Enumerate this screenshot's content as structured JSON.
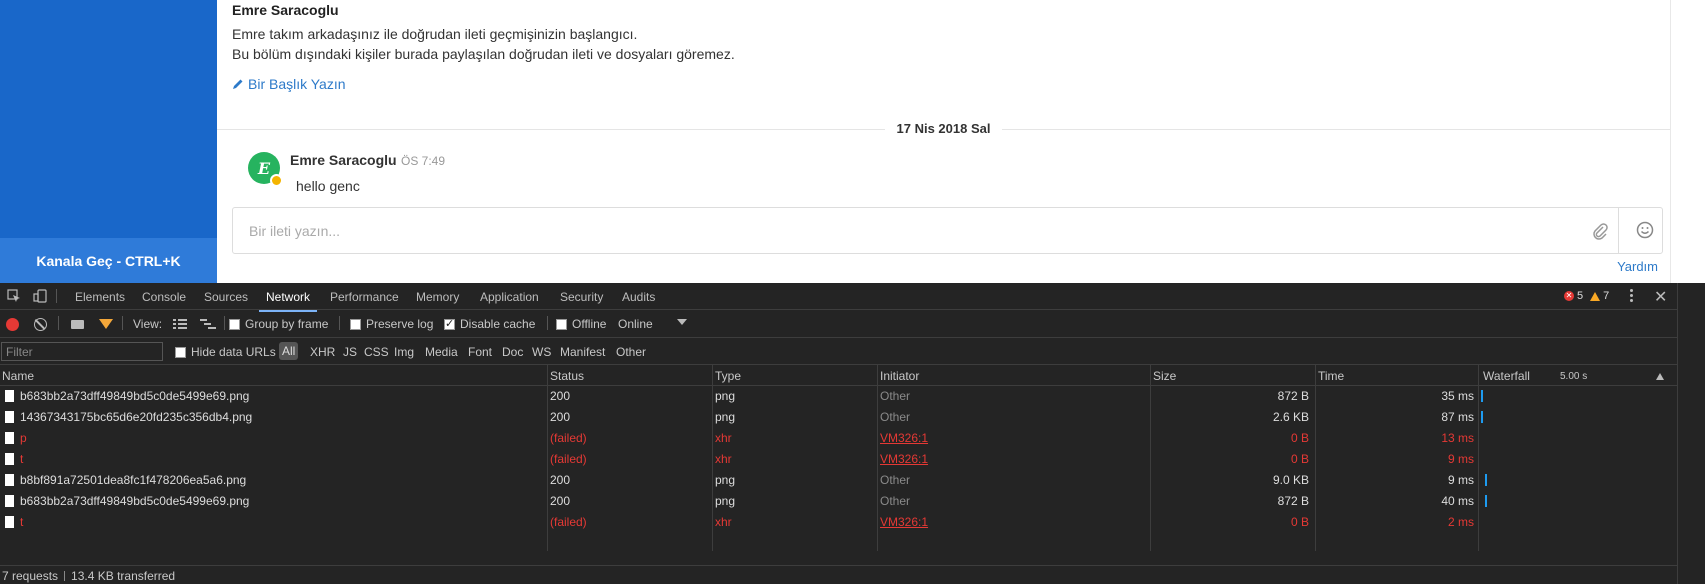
{
  "sidebar": {
    "switcher_label": "Kanala Geç - CTRL+K"
  },
  "intro": {
    "name": "Emre Saracoglu",
    "line1": "Emre takım arkadaşınız ile doğrudan ileti geçmişinizin başlangıcı.",
    "line2": "Bu bölüm dışındaki kişiler burada paylaşılan doğrudan ileti ve dosyaları göremez.",
    "set_title": "Bir Başlık Yazın"
  },
  "date_divider": "17 Nis 2018 Sal",
  "message": {
    "avatar_letter": "E",
    "author": "Emre Saracoglu",
    "time": "ÖS 7:49",
    "body": "hello genc"
  },
  "composer": {
    "placeholder": "Bir ileti yazın..."
  },
  "help_label": "Yardım",
  "devtools": {
    "tabs": [
      "Elements",
      "Console",
      "Sources",
      "Network",
      "Performance",
      "Memory",
      "Application",
      "Security",
      "Audits"
    ],
    "active_tab": "Network",
    "errors": "5",
    "warnings": "7",
    "toolbar": {
      "view_label": "View:",
      "group_by_frame": "Group by frame",
      "preserve_log": "Preserve log",
      "disable_cache": "Disable cache",
      "offline": "Offline",
      "online": "Online"
    },
    "filter": {
      "placeholder": "Filter",
      "hide_data_urls": "Hide data URLs",
      "types": [
        "All",
        "XHR",
        "JS",
        "CSS",
        "Img",
        "Media",
        "Font",
        "Doc",
        "WS",
        "Manifest",
        "Other"
      ]
    },
    "columns": {
      "name": "Name",
      "status": "Status",
      "type": "Type",
      "initiator": "Initiator",
      "size": "Size",
      "time": "Time",
      "waterfall": "Waterfall",
      "waterfall_scale": "5.00 s"
    },
    "requests": [
      {
        "name": "b683bb2a73dff49849bd5c0de5499e69.png",
        "status": "200",
        "type": "png",
        "initiator": "Other",
        "size": "872 B",
        "time": "35 ms",
        "failed": false
      },
      {
        "name": "14367343175bc65d6e20fd235c356db4.png",
        "status": "200",
        "type": "png",
        "initiator": "Other",
        "size": "2.6 KB",
        "time": "87 ms",
        "failed": false
      },
      {
        "name": "p",
        "status": "(failed)",
        "type": "xhr",
        "initiator": "VM326:1",
        "size": "0 B",
        "time": "13 ms",
        "failed": true
      },
      {
        "name": "t",
        "status": "(failed)",
        "type": "xhr",
        "initiator": "VM326:1",
        "size": "0 B",
        "time": "9 ms",
        "failed": true
      },
      {
        "name": "b8bf891a72501dea8fc1f478206ea5a6.png",
        "status": "200",
        "type": "png",
        "initiator": "Other",
        "size": "9.0 KB",
        "time": "9 ms",
        "failed": false
      },
      {
        "name": "b683bb2a73dff49849bd5c0de5499e69.png",
        "status": "200",
        "type": "png",
        "initiator": "Other",
        "size": "872 B",
        "time": "40 ms",
        "failed": false
      },
      {
        "name": "t",
        "status": "(failed)",
        "type": "xhr",
        "initiator": "VM326:1",
        "size": "0 B",
        "time": "2 ms",
        "failed": true
      }
    ],
    "summary": {
      "requests": "7 requests",
      "transferred": "13.4 KB transferred"
    }
  },
  "colors": {
    "sidebar": "#1967c9",
    "link": "#2d7ac9",
    "avatar": "#26b35f",
    "devtools_bg": "#242424",
    "failed": "#e53935",
    "waterfall": "#1e9bf0"
  }
}
